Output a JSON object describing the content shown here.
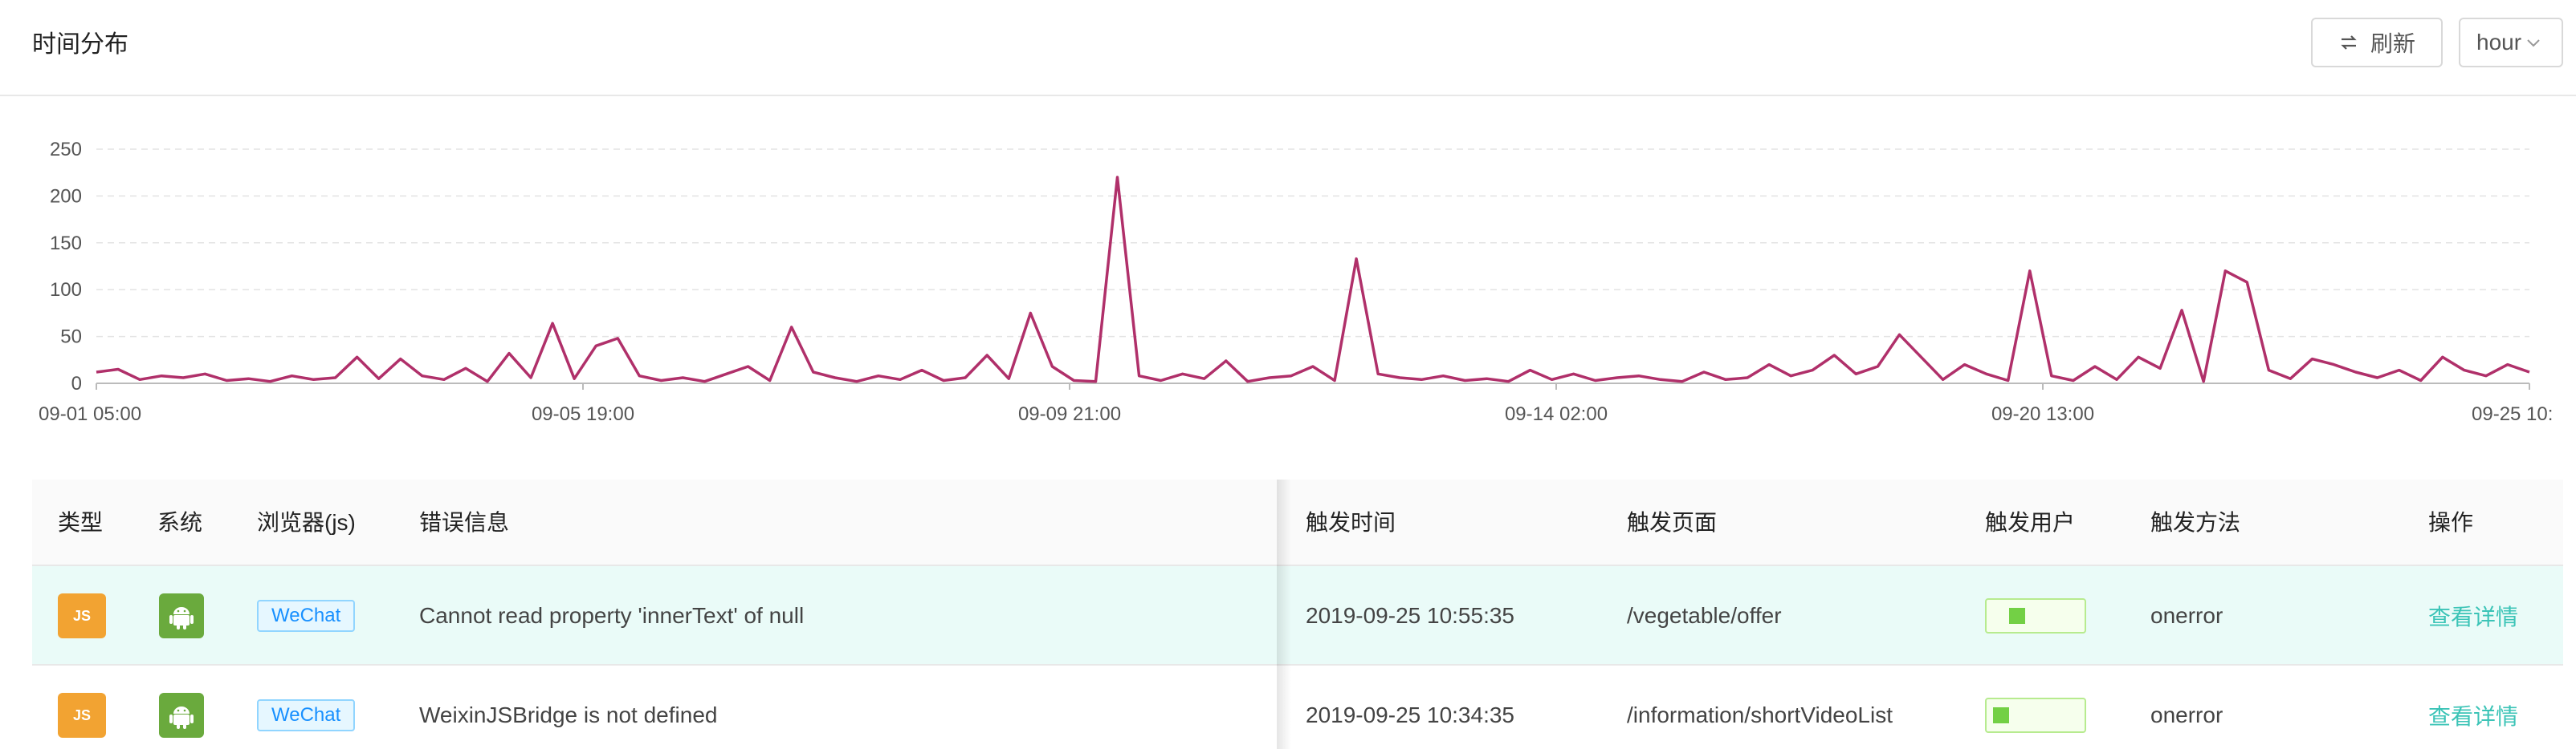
{
  "header": {
    "title": "时间分布",
    "refresh_label": "刷新",
    "granularity_value": "hour"
  },
  "chart_data": {
    "type": "line",
    "title": "",
    "xlabel": "",
    "ylabel": "",
    "ylim": [
      0,
      250
    ],
    "yticks": [
      0,
      50,
      100,
      150,
      200,
      250
    ],
    "grid": "horizontal-dashed",
    "legend": "none",
    "color": "#b0306a",
    "x_tick_labels": [
      "09-01 05:00",
      "09-05 19:00",
      "09-09 21:00",
      "09-14 02:00",
      "09-20 13:00",
      "09-25 10:"
    ],
    "x": [
      "09-01 05:00",
      "09-01 10:00",
      "09-01 15:00",
      "09-01 20:00",
      "09-02 01:00",
      "09-02 06:00",
      "09-02 11:00",
      "09-02 16:00",
      "09-02 21:00",
      "09-03 02:00",
      "09-03 07:00",
      "09-03 12:00",
      "09-03 17:00",
      "09-03 22:00",
      "09-04 03:00",
      "09-04 08:00",
      "09-04 13:00",
      "09-04 18:00",
      "09-04 23:00",
      "09-05 04:00",
      "09-05 09:00",
      "09-05 14:00",
      "09-05 19:00",
      "09-06 00:00",
      "09-06 05:00",
      "09-06 10:00",
      "09-06 15:00",
      "09-06 20:00",
      "09-07 01:00",
      "09-07 06:00",
      "09-07 11:00",
      "09-07 16:00",
      "09-07 21:00",
      "09-08 02:00",
      "09-08 07:00",
      "09-08 12:00",
      "09-08 17:00",
      "09-08 22:00",
      "09-09 03:00",
      "09-09 08:00",
      "09-09 13:00",
      "09-09 18:00",
      "09-09 21:00",
      "09-10 02:00",
      "09-10 07:00",
      "09-10 12:00",
      "09-10 17:00",
      "09-10 22:00",
      "09-11 03:00",
      "09-11 08:00",
      "09-11 13:00",
      "09-11 18:00",
      "09-11 23:00",
      "09-12 04:00",
      "09-12 09:00",
      "09-12 14:00",
      "09-12 19:00",
      "09-13 00:00",
      "09-13 05:00",
      "09-13 10:00",
      "09-13 15:00",
      "09-13 20:00",
      "09-14 02:00",
      "09-14 07:00",
      "09-14 12:00",
      "09-14 17:00",
      "09-14 22:00",
      "09-15 03:00",
      "09-15 08:00",
      "09-15 13:00",
      "09-15 18:00",
      "09-15 23:00",
      "09-16 04:00",
      "09-16 09:00",
      "09-16 14:00",
      "09-16 19:00",
      "09-17 00:00",
      "09-17 05:00",
      "09-17 10:00",
      "09-17 15:00",
      "09-17 20:00",
      "09-18 01:00",
      "09-18 06:00",
      "09-18 11:00",
      "09-18 16:00",
      "09-18 21:00",
      "09-19 02:00",
      "09-19 07:00",
      "09-19 12:00",
      "09-19 17:00",
      "09-19 22:00",
      "09-20 03:00",
      "09-20 08:00",
      "09-20 13:00",
      "09-20 18:00",
      "09-20 23:00",
      "09-21 04:00",
      "09-21 09:00",
      "09-21 14:00",
      "09-21 19:00",
      "09-22 00:00",
      "09-22 05:00",
      "09-22 10:00",
      "09-22 15:00",
      "09-22 20:00",
      "09-23 01:00",
      "09-23 06:00",
      "09-23 11:00",
      "09-23 16:00",
      "09-23 21:00",
      "09-24 02:00",
      "09-24 07:00",
      "09-24 12:00",
      "09-24 17:00",
      "09-24 22:00",
      "09-25 03:00",
      "09-25 10:00"
    ],
    "values": [
      12,
      15,
      4,
      8,
      6,
      10,
      3,
      5,
      2,
      8,
      4,
      6,
      28,
      5,
      26,
      8,
      4,
      16,
      2,
      32,
      6,
      64,
      5,
      40,
      48,
      8,
      3,
      6,
      2,
      10,
      18,
      3,
      60,
      12,
      6,
      2,
      8,
      4,
      14,
      3,
      6,
      30,
      5,
      75,
      18,
      3,
      2,
      220,
      8,
      3,
      10,
      5,
      24,
      2,
      6,
      8,
      18,
      3,
      133,
      10,
      6,
      4,
      8,
      3,
      5,
      2,
      14,
      4,
      10,
      3,
      6,
      8,
      4,
      2,
      12,
      4,
      6,
      20,
      8,
      14,
      30,
      10,
      18,
      52,
      28,
      4,
      20,
      10,
      3,
      120,
      8,
      3,
      18,
      4,
      28,
      16,
      78,
      2,
      120,
      108,
      14,
      5,
      26,
      20,
      12,
      6,
      14,
      3,
      28,
      14,
      8,
      20,
      12
    ],
    "note_series_length": "approximate readings"
  },
  "table": {
    "columns": [
      "类型",
      "系统",
      "浏览器(js)",
      "错误信息",
      "触发时间",
      "触发页面",
      "触发用户",
      "触发方法",
      "操作"
    ],
    "rows": [
      {
        "type_badge": "JS",
        "os_icon": "android-icon",
        "browser": "WeChat",
        "message": "Cannot read property 'innerText' of null",
        "time": "2019-09-25 10:55:35",
        "page": "/vegetable/offer",
        "user_level": 0.1,
        "method": "onerror",
        "action": "查看详情"
      },
      {
        "type_badge": "JS",
        "os_icon": "android-icon",
        "browser": "WeChat",
        "message": "WeixinJSBridge is not defined",
        "time": "2019-09-25 10:34:35",
        "page": "/information/shortVideoList",
        "user_level": 0.05,
        "method": "onerror",
        "action": "查看详情"
      }
    ]
  },
  "colors": {
    "accent": "#3cc4b7",
    "line": "#b0306a",
    "row_highlight": "#eafbf8",
    "js_badge": "#f2a332",
    "android_badge": "#6aaa3d"
  }
}
